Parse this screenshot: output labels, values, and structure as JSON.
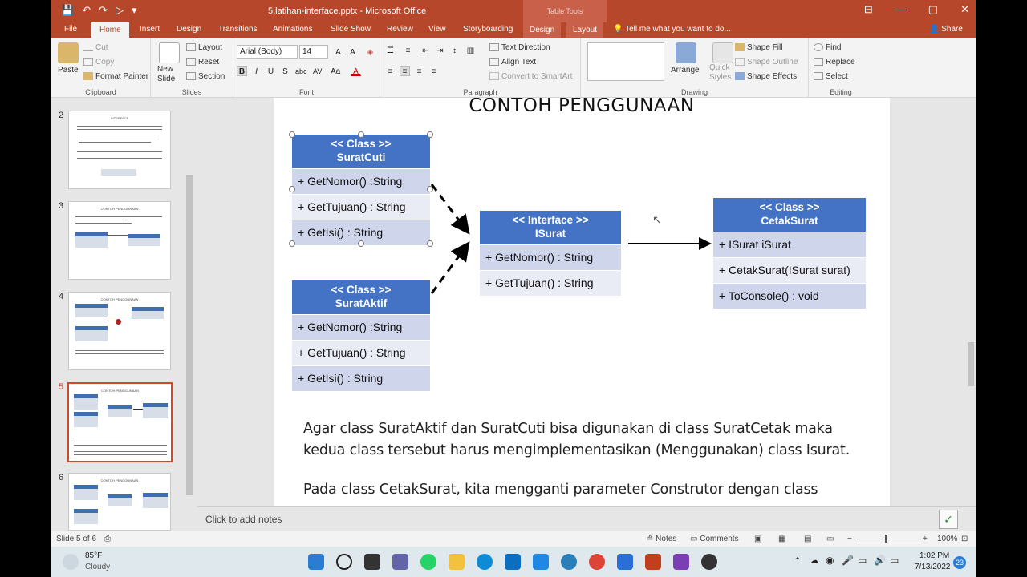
{
  "window": {
    "title": "5.latihan-interface.pptx - Microsoft Office",
    "context_tab_group": "Table Tools",
    "minimize": "—",
    "maximize": "▢",
    "close": "✕",
    "ribbon_display": "⊟"
  },
  "qat": {
    "save": "💾",
    "undo": "↶",
    "redo": "↷",
    "start": "▷",
    "customize": "▾"
  },
  "tabs": [
    "File",
    "Home",
    "Insert",
    "Design",
    "Transitions",
    "Animations",
    "Slide Show",
    "Review",
    "View",
    "Storyboarding",
    "Design",
    "Layout"
  ],
  "tell_me": "Tell me what you want to do...",
  "share": "Share",
  "ribbon": {
    "clipboard": {
      "label": "Clipboard",
      "paste": "Paste",
      "cut": "Cut",
      "copy": "Copy",
      "format_painter": "Format Painter"
    },
    "slides": {
      "label": "Slides",
      "new_slide": "New\nSlide",
      "layout": "Layout",
      "reset": "Reset",
      "section": "Section"
    },
    "font": {
      "label": "Font",
      "family": "Arial (Body)",
      "size": "14"
    },
    "paragraph": {
      "label": "Paragraph",
      "text_direction": "Text Direction",
      "align_text": "Align Text",
      "convert": "Convert to SmartArt"
    },
    "drawing": {
      "label": "Drawing",
      "arrange": "Arrange",
      "quick_styles": "Quick\nStyles",
      "shape_fill": "Shape Fill",
      "shape_outline": "Shape Outline",
      "shape_effects": "Shape Effects"
    },
    "editing": {
      "label": "Editing",
      "find": "Find",
      "replace": "Replace",
      "select": "Select"
    }
  },
  "thumbnails": [
    {
      "num": "2",
      "title": "INTERFACE"
    },
    {
      "num": "3",
      "title": "CONTOH PENGGUNAAN"
    },
    {
      "num": "4",
      "title": "CONTOH PENGGUNAAN"
    },
    {
      "num": "5",
      "title": "CONTOH PENGGUNAAN"
    },
    {
      "num": "6",
      "title": "CONTOH PENGGUNAAN"
    }
  ],
  "slide": {
    "heading": "CONTOH PENGGUNAAN",
    "classes": {
      "suratcuti": {
        "header": [
          "<< Class >>",
          "SuratCuti"
        ],
        "rows": [
          "+ GetNomor() :String",
          "+ GetTujuan() : String",
          "+ GetIsi() : String"
        ]
      },
      "surataktif": {
        "header": [
          "<< Class >>",
          "SuratAktif"
        ],
        "rows": [
          "+ GetNomor() :String",
          "+ GetTujuan() : String",
          "+ GetIsi() : String"
        ]
      },
      "isurat": {
        "header": [
          "<< Interface >>",
          "ISurat"
        ],
        "rows": [
          "+ GetNomor() : String",
          "+ GetTujuan() : String"
        ]
      },
      "cetaksurat": {
        "header": [
          "<< Class >>",
          "CetakSurat"
        ],
        "rows": [
          "+ ISurat iSurat",
          "+ CetakSurat(ISurat surat)",
          "+ ToConsole() : void"
        ]
      }
    },
    "paragraph1": [
      "Agar class SuratAktif dan SuratCuti bisa digunakan di class SuratCetak maka",
      "kedua class tersebut harus mengimplementasikan (Menggunakan) class Isurat."
    ],
    "paragraph2": "Pada class CetakSurat, kita mengganti parameter Construtor dengan class"
  },
  "notes_placeholder": "Click to add notes",
  "status": {
    "slide_of": "Slide 5 of 6",
    "notes": "Notes",
    "comments": "Comments",
    "zoom": "100%"
  },
  "taskbar": {
    "weather_temp": "85°F",
    "weather_desc": "Cloudy",
    "time": "1:02 PM",
    "date": "7/13/2022",
    "notif": "23"
  },
  "colors": {
    "accent": "#b7472a",
    "uml_header": "#4472c4",
    "uml_row1": "#cfd5ea",
    "uml_row2": "#e9ebf5"
  }
}
